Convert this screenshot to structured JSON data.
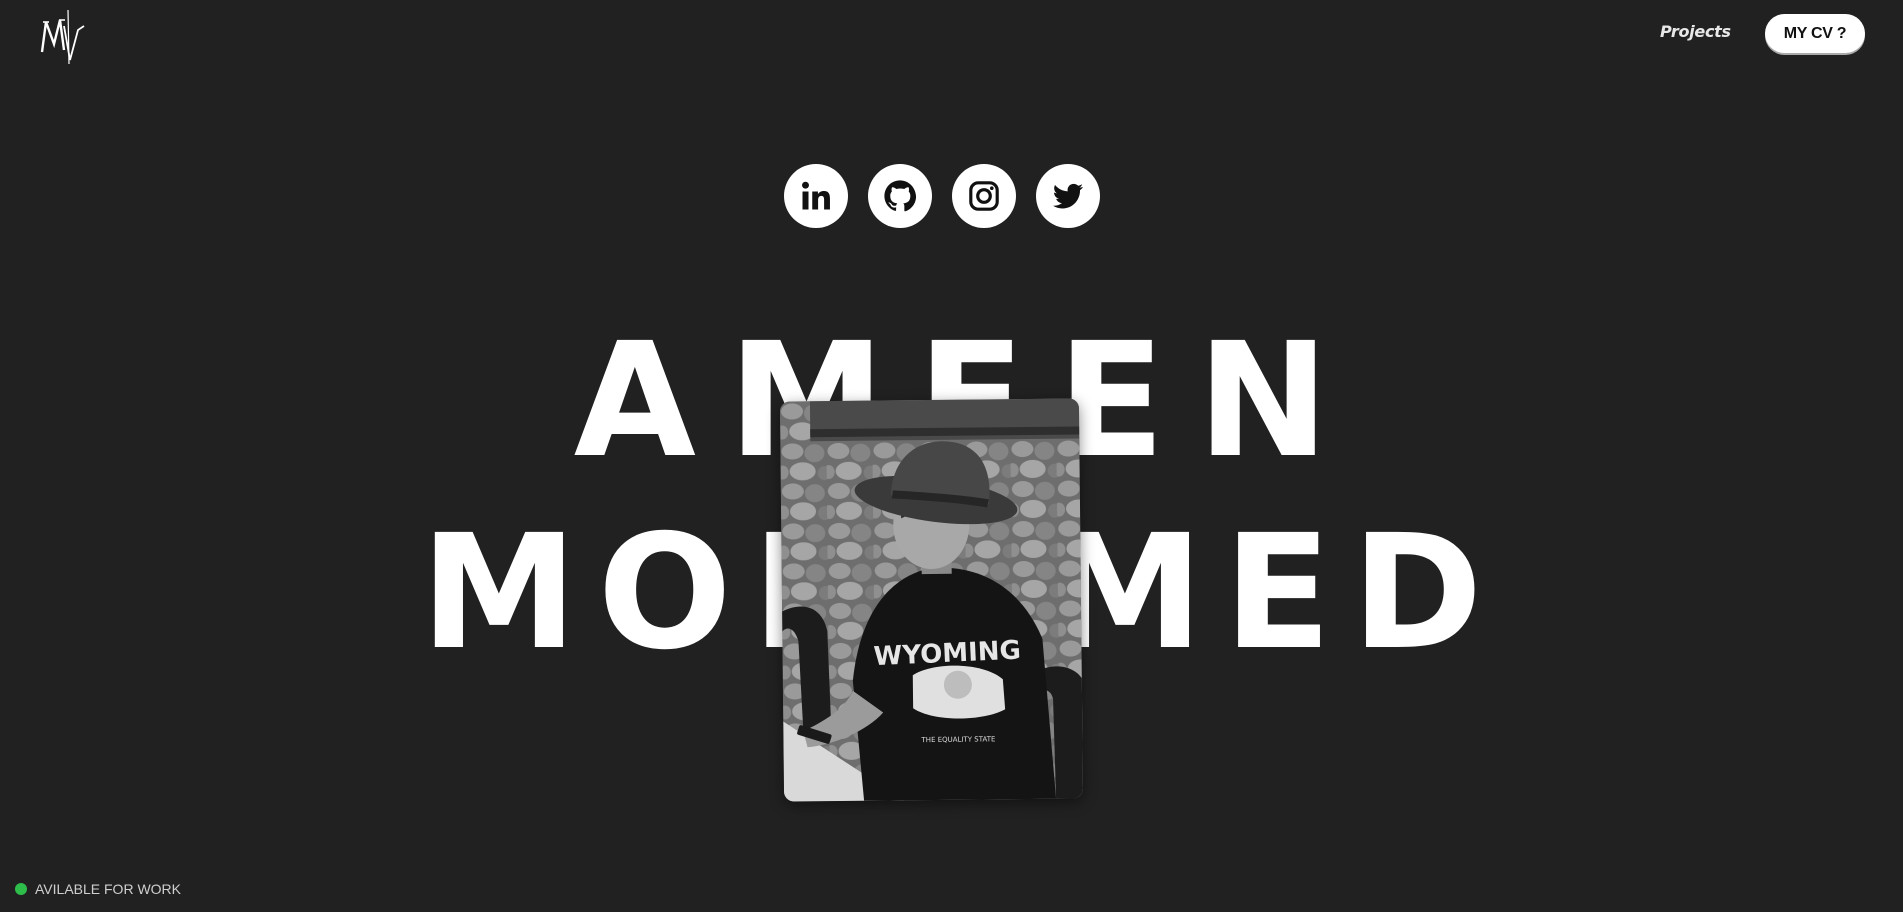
{
  "header": {
    "logo_text": "MV",
    "nav_projects": "Projects",
    "cv_button": "MY CV ?"
  },
  "socials": [
    {
      "name": "LinkedIn",
      "icon": "linkedin-icon"
    },
    {
      "name": "GitHub",
      "icon": "github-icon"
    },
    {
      "name": "Instagram",
      "icon": "instagram-icon"
    },
    {
      "name": "Twitter",
      "icon": "twitter-icon"
    }
  ],
  "hero": {
    "first_name": "AMEEN",
    "last_name": "MOHAMED",
    "portrait_shirt_text": "WYOMING",
    "portrait_shirt_subtext": "THE EQUALITY STATE"
  },
  "status": {
    "text": "AVILABLE FOR WORK",
    "color": "#2ebd4a"
  },
  "colors": {
    "background": "#212121",
    "text": "#ffffff",
    "button_bg": "#ffffff",
    "button_text": "#111111"
  }
}
